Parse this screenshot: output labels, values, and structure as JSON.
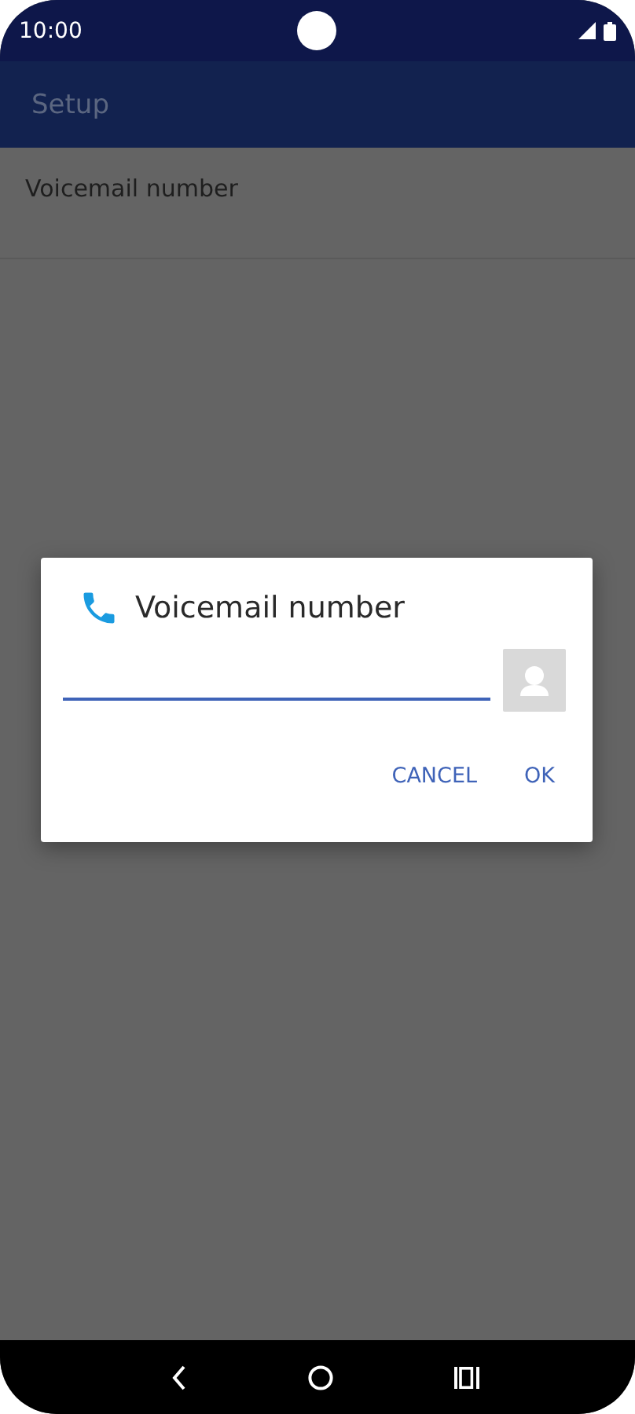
{
  "status_bar": {
    "time": "10:00"
  },
  "app_bar": {
    "title": "Setup"
  },
  "list": [
    {
      "title": "Voicemail number"
    }
  ],
  "dialog": {
    "title": "Voicemail number",
    "field": {
      "focused": true
    },
    "buttons": [
      "CANCEL",
      "OK"
    ]
  }
}
